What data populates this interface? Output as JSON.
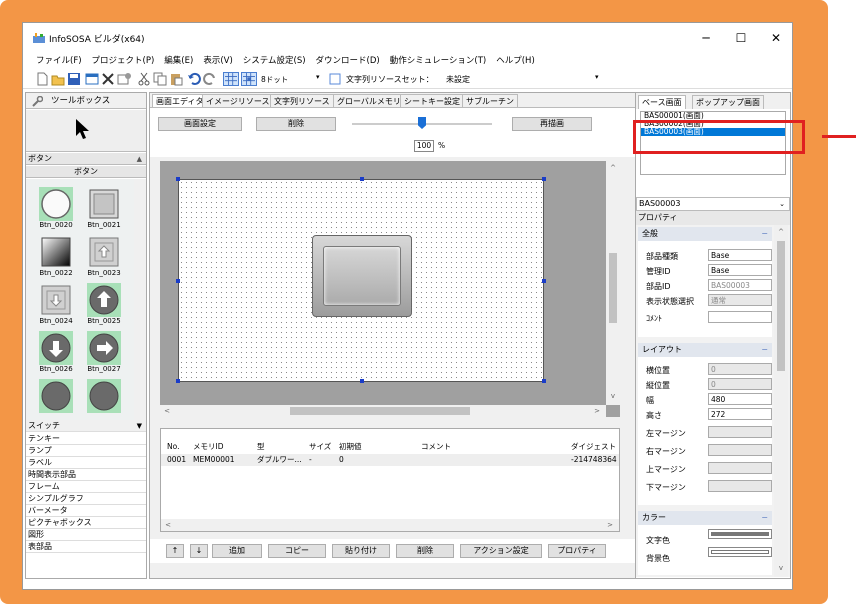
{
  "window": {
    "title": "InfoSOSA ビルダ(x64)",
    "min_btn": "─",
    "max_btn": "☐",
    "close_btn": "✕"
  },
  "menu": [
    "ファイル(F)",
    "プロジェクト(P)",
    "編集(E)",
    "表示(V)",
    "システム設定(S)",
    "ダウンロード(D)",
    "動作シミュレーション(T)",
    "ヘルプ(H)"
  ],
  "toolbar": {
    "dot_label": "8ドット",
    "charset_label": "文字列リソースセット：",
    "charset_value": "未設定"
  },
  "toolbox": {
    "title": "ツールボックス",
    "category": "ボタン",
    "subcategory": "ボタン",
    "buttons": [
      {
        "name": "Btn_0020"
      },
      {
        "name": "Btn_0021"
      },
      {
        "name": "Btn_0022"
      },
      {
        "name": "Btn_0023"
      },
      {
        "name": "Btn_0024"
      },
      {
        "name": "Btn_0025"
      },
      {
        "name": "Btn_0026"
      },
      {
        "name": "Btn_0027"
      }
    ],
    "categories": [
      "スイッチ",
      "テンキー",
      "ランプ",
      "ラベル",
      "時間表示部品",
      "フレーム",
      "シンプルグラフ",
      "バーメータ",
      "ピクチャボックス",
      "図形",
      "表部品"
    ]
  },
  "tabs": [
    "画面エディタ",
    "イメージリソース",
    "文字列リソース",
    "グローバルメモリ",
    "シートキー設定",
    "サブルーチン"
  ],
  "editor": {
    "screen_settings": "画面設定",
    "delete": "削除",
    "zoom": "100",
    "zoom_unit": "%",
    "redraw": "再描画"
  },
  "memory_table": {
    "headers": [
      "No.",
      "メモリID",
      "型",
      "サイズ",
      "初期値",
      "コメント",
      "ダイジェスト"
    ],
    "rows": [
      [
        "0001",
        "MEM00001",
        "ダブルワー...",
        "-",
        "0",
        "",
        "-214748364"
      ]
    ]
  },
  "bottom_buttons": {
    "up": "↑",
    "down": "↓",
    "add": "追加",
    "copy": "コピー",
    "paste": "貼り付け",
    "delete": "削除",
    "action": "アクション設定",
    "property": "プロパティ"
  },
  "right": {
    "tabs": [
      "ベース画面",
      "ポップアップ画面"
    ],
    "screens": [
      "BAS00001(画面)",
      "BAS00002(画面)",
      "BAS00003(画面)"
    ],
    "selected_combo": "BAS00003",
    "property_header": "プロパティ",
    "groups": {
      "general": "全般",
      "layout": "レイアウト",
      "color": "カラー"
    },
    "general": [
      {
        "label": "部品種類",
        "value": "Base"
      },
      {
        "label": "管理ID",
        "value": "Base"
      },
      {
        "label": "部品ID",
        "value": "BAS00003"
      },
      {
        "label": "表示状態選択",
        "value": "通常"
      },
      {
        "label": "ｺﾒﾝﾄ",
        "value": ""
      }
    ],
    "layout": [
      {
        "label": "横位置",
        "value": "0"
      },
      {
        "label": "縦位置",
        "value": "0"
      },
      {
        "label": "幅",
        "value": "480"
      },
      {
        "label": "高さ",
        "value": "272"
      },
      {
        "label": "左マージン",
        "value": ""
      },
      {
        "label": "右マージン",
        "value": ""
      },
      {
        "label": "上マージン",
        "value": ""
      },
      {
        "label": "下マージン",
        "value": ""
      }
    ],
    "color": [
      {
        "label": "文字色"
      },
      {
        "label": "背景色"
      }
    ]
  }
}
